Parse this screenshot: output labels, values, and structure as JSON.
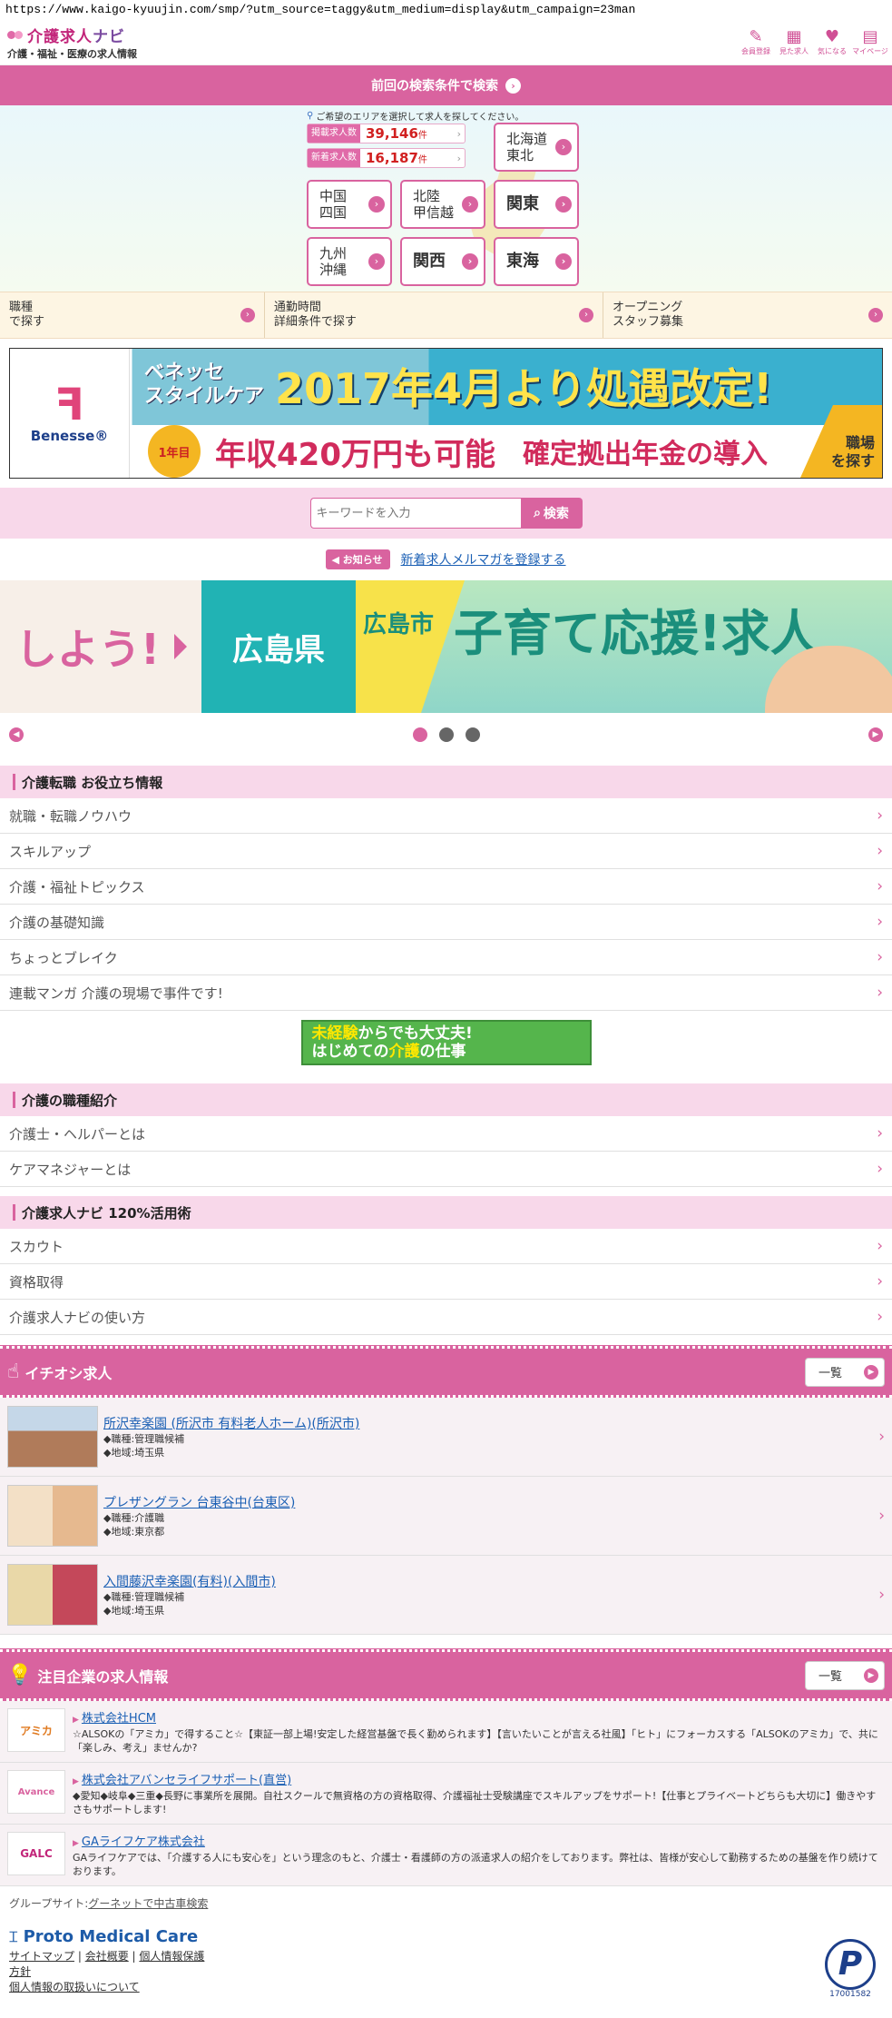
{
  "url": "https://www.kaigo-kyuujin.com/smp/?utm_source=taggy&utm_medium=display&utm_campaign=23man",
  "header": {
    "logo_name": "介護求人",
    "logo_name2": "ナビ",
    "logo_sub": "介護・福祉・医療の求人情報",
    "icons": [
      {
        "label": "会員登録",
        "icon": "pencil-icon"
      },
      {
        "label": "見た求人",
        "icon": "calendar-icon"
      },
      {
        "label": "気になる",
        "icon": "heart-icon"
      },
      {
        "label": "マイページ",
        "icon": "mypage-icon"
      }
    ]
  },
  "prev_search": {
    "label": "前回の検索条件で検索"
  },
  "area": {
    "hint": "ご希望のエリアを選択して求人を探してください。",
    "stats": [
      {
        "label": "掲載求人数",
        "value": "39,146",
        "unit": "件"
      },
      {
        "label": "新着求人数",
        "value": "16,187",
        "unit": "件"
      }
    ],
    "regions": {
      "hokkaido": "北海道\n東北",
      "chugoku": "中国\n四国",
      "hokuriku": "北陸\n甲信越",
      "kanto": "関東",
      "kyushu": "九州\n沖縄",
      "kansai": "関西",
      "tokai": "東海"
    }
  },
  "search_by": [
    {
      "label": "職種\nで探す"
    },
    {
      "label": "通勤時間\n詳細条件で探す"
    },
    {
      "label": "オープニング\nスタッフ募集"
    }
  ],
  "benesse_banner": {
    "brand": "Benesse®",
    "company": "ベネッセ\nスタイルケア",
    "headline": "2017年4月より処遇改定!",
    "badge": "1年目",
    "salary": "年収420万円も可能",
    "pension": "確定拠出年金の導入",
    "cta": "職場\nを探す"
  },
  "keyword": {
    "placeholder": "キーワードを入力",
    "button": "検索"
  },
  "notice": {
    "badge": "お知らせ",
    "link": "新着求人メルマガを登録する"
  },
  "carousel": {
    "left_text": "しよう!",
    "pref": "広島県",
    "city": "広島市",
    "slogan": "子育て応援!求人"
  },
  "sections": [
    {
      "title": "介護転職 お役立ち情報",
      "items": [
        "就職・転職ノウハウ",
        "スキルアップ",
        "介護・福祉トピックス",
        "介護の基礎知識",
        "ちょっとブレイク",
        "連載マンガ 介護の現場で事件です!"
      ]
    },
    {
      "title": "介護の職種紹介",
      "items": [
        "介護士・ヘルパーとは",
        "ケアマネジャーとは"
      ]
    },
    {
      "title": "介護求人ナビ 120%活用術",
      "items": [
        "スカウト",
        "資格取得",
        "介護求人ナビの使い方"
      ]
    }
  ],
  "mini_banner": {
    "line1": "未経験",
    "line1b": "からでも大丈夫!",
    "line2": "はじめての",
    "line2b": "介護",
    "line2c": "の仕事"
  },
  "pickup": {
    "title": "イチオシ求人",
    "all_label": "一覧",
    "jobs": [
      {
        "title": "所沢幸楽園 (所沢市 有料老人ホーム)(所沢市)",
        "role": "◆職種:管理職候補",
        "area": "◆地域:埼玉県"
      },
      {
        "title": "プレザングラン 台東谷中(台東区)",
        "role": "◆職種:介護職",
        "area": "◆地域:東京都"
      },
      {
        "title": "入間藤沢幸楽園(有料)(入間市)",
        "role": "◆職種:管理職候補",
        "area": "◆地域:埼玉県"
      }
    ]
  },
  "companies": {
    "title": "注目企業の求人情報",
    "all_label": "一覧",
    "items": [
      {
        "name": "株式会社HCM",
        "logo": "アミカ",
        "desc": "☆ALSOKの「アミカ」で得すること☆【東証一部上場!安定した経営基盤で長く勤められます】【言いたいことが言える社風】「ヒト」にフォーカスする「ALSOKのアミカ」で、共に「楽しみ、考え」ませんか?"
      },
      {
        "name": "株式会社アバンセライフサポート(直営)",
        "logo": "Avance",
        "desc": "◆愛知◆岐阜◆三重◆長野に事業所を展開。自社スクールで無資格の方の資格取得、介護福祉士受験講座でスキルアップをサポート!【仕事とプライベートどちらも大切に】働きやすさもサポートします!"
      },
      {
        "name": "GAライフケア株式会社",
        "logo": "GALC",
        "desc": "GAライフケアでは、「介護する人にも安心を」という理念のもと、介護士・看護師の方の派遣求人の紹介をしております。弊社は、皆様が安心して勤務するための基盤を作り続けております。"
      }
    ]
  },
  "footer": {
    "group_label": "グループサイト:",
    "group_link": "グーネットで中古車検索",
    "brand": "Proto Medical Care",
    "links": [
      "サイトマップ",
      "会社概要",
      "個人情報保護"
    ],
    "link_policy": "方針",
    "link_handling": "個人情報の取扱いについて",
    "pmark_num": "17001582"
  },
  "colors": {
    "accent": "#d9639f",
    "link": "#1a5fb4",
    "section_bg": "#f8d8ea"
  }
}
